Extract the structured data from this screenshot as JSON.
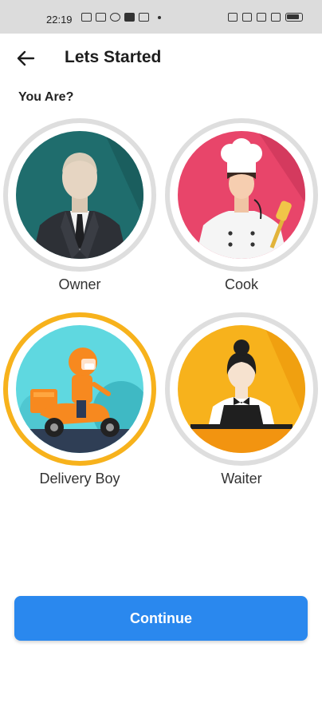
{
  "status_bar": {
    "time": "22:19"
  },
  "header": {
    "title": "Lets Started",
    "back_icon": "arrow-left-icon"
  },
  "question": "You Are?",
  "roles": [
    {
      "label": "Owner",
      "selected": false
    },
    {
      "label": "Cook",
      "selected": false
    },
    {
      "label": "Delivery Boy",
      "selected": true
    },
    {
      "label": "Waiter",
      "selected": false
    }
  ],
  "continue_label": "Continue",
  "colors": {
    "primary": "#2a88ee",
    "selected_ring": "#f7b21c",
    "ring": "#dedede"
  }
}
